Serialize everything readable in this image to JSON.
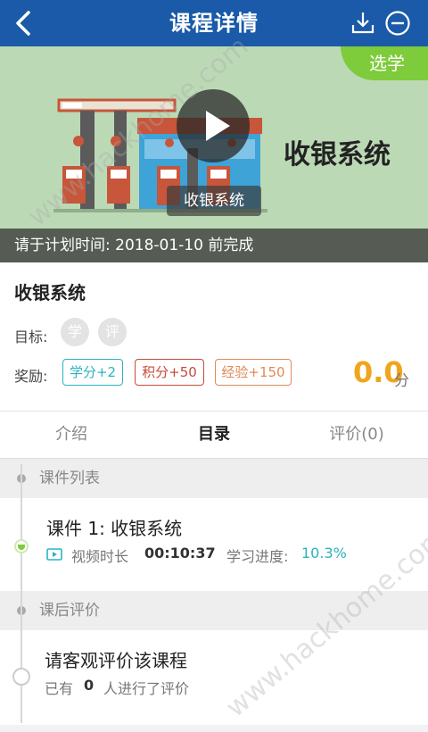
{
  "header": {
    "title": "课程详情",
    "back_icon": "back-arrow-icon",
    "download_icon": "download-icon",
    "minus_icon": "minus-circle-icon",
    "color": "#1a5aa8"
  },
  "hero": {
    "ribbon": "选学",
    "course_title_big": "收银系统",
    "video_caption": "收银系统",
    "plan_text": "请于计划时间: 2018-01-10 前完成",
    "bg_color": "#bcd9b6",
    "ribbon_color": "#7ecb3b"
  },
  "course": {
    "name": "收银系统",
    "goal_label": "目标:",
    "goal_badges": [
      "学",
      "评"
    ],
    "reward_label": "奖励:",
    "rewards": [
      {
        "text": "学分+2",
        "color": "#2bb3c0"
      },
      {
        "text": "积分+50",
        "color": "#c84a3a"
      },
      {
        "text": "经验+150",
        "color": "#e08a5a"
      }
    ],
    "score": "0.0",
    "score_unit": "分",
    "score_color": "#f0a51c"
  },
  "tabs": [
    {
      "label": "介绍",
      "active": false
    },
    {
      "label": "目录",
      "active": true
    },
    {
      "label": "评价(0)",
      "active": false
    }
  ],
  "catalog": {
    "section_title": "课件列表",
    "item_title": "课件  1: 收银系统",
    "video_label": "视频时长",
    "duration": "00:10:37",
    "progress_label": "学习进度:",
    "progress": "10.3%",
    "progress_color": "#2bb3c0"
  },
  "review": {
    "section_title": "课后评价",
    "item_title": "请客观评价该课程",
    "count_prefix": "已有",
    "count": "0",
    "count_suffix": "人进行了评价"
  },
  "watermark": "www.hackhome.com"
}
